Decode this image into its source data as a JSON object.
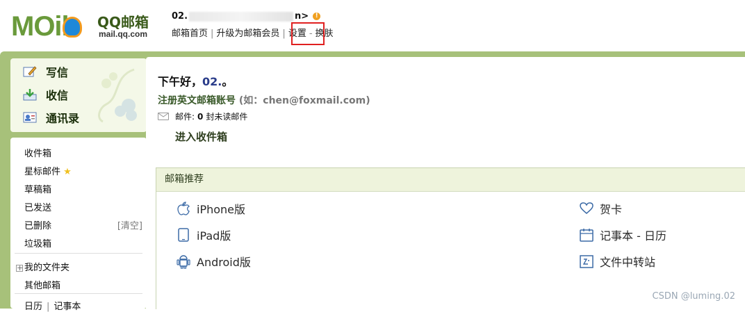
{
  "brand": {
    "logo_text": "MOil",
    "name": "QQ邮箱",
    "url": "mail.qq.com"
  },
  "user": {
    "prefix": "02.",
    "suffix": "n>"
  },
  "toplinks": [
    "邮箱首页",
    "升级为邮箱会员",
    "设置",
    "换肤"
  ],
  "sidebar": {
    "primary": [
      "写信",
      "收信",
      "通讯录"
    ],
    "folders": [
      "收件箱",
      "星标邮件",
      "草稿箱",
      "已发送",
      "已删除",
      "垃圾箱"
    ],
    "clear_label": "[清空]",
    "my_folders": "我的文件夹",
    "other_mailbox": "其他邮箱",
    "bottom": [
      "日历",
      "记事本"
    ]
  },
  "main": {
    "greeting": "下午好，",
    "greeting_name": "02.",
    "greeting_end": "。",
    "register_text": "注册英文邮箱账号",
    "register_hint": "(如：chen@foxmail.com)",
    "mail_label": "邮件:",
    "mail_count": "0",
    "mail_suffix": "封未读邮件",
    "inbox_link": "进入收件箱"
  },
  "recommend": {
    "title": "邮箱推荐",
    "left": [
      "iPhone版",
      "iPad版",
      "Android版"
    ],
    "right": [
      "贺卡",
      "记事本 - 日历",
      "文件中转站"
    ]
  },
  "watermark": "CSDN @luming.02",
  "colors": {
    "frame": "#a7c17a",
    "highlight": "#e02020"
  }
}
